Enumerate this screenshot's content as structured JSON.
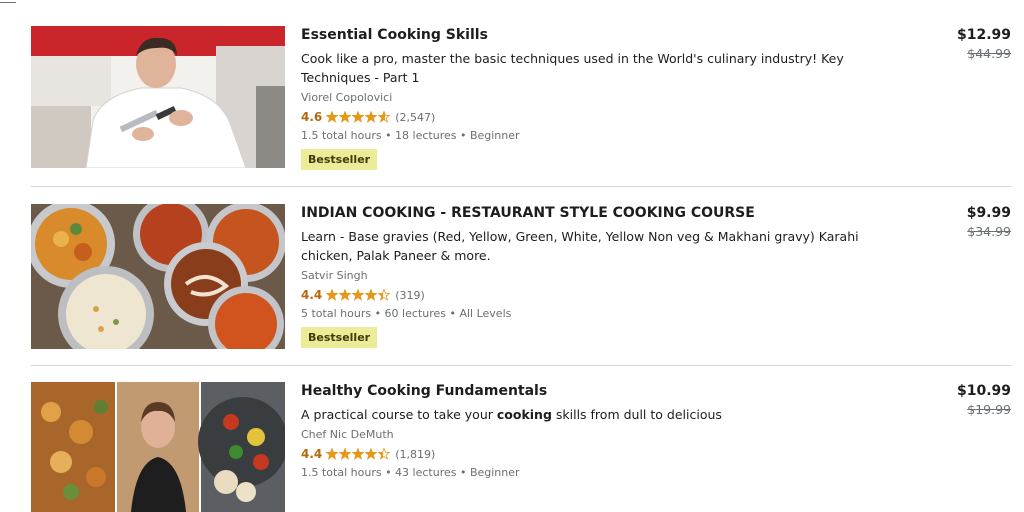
{
  "courses": [
    {
      "title": "Essential Cooking Skills",
      "headline": "Cook like a pro, master the basic techniques used in the World's culinary industry! Key Techniques - Part 1",
      "instructor": "Viorel Copolovici",
      "rating": "4.6",
      "rating_stars": 4.6,
      "rating_count": "(2,547)",
      "meta": "1.5 total hours • 18 lectures • Beginner",
      "badge": "Bestseller",
      "price_current": "$12.99",
      "price_original": "$44.99"
    },
    {
      "title": "INDIAN COOKING - RESTAURANT STYLE COOKING COURSE",
      "headline": "Learn - Base gravies (Red, Yellow, Green, White, Yellow Non veg & Makhani gravy) Karahi chicken, Palak Paneer & more.",
      "instructor": "Satvir Singh",
      "rating": "4.4",
      "rating_stars": 4.4,
      "rating_count": "(319)",
      "meta": "5 total hours • 60 lectures • All Levels",
      "badge": "Bestseller",
      "price_current": "$9.99",
      "price_original": "$34.99"
    },
    {
      "title": "Healthy Cooking Fundamentals",
      "headline_pre": "A practical course to take your ",
      "headline_bold": "cooking",
      "headline_post": " skills from dull to delicious",
      "instructor": "Chef Nic DeMuth",
      "rating": "4.4",
      "rating_stars": 4.4,
      "rating_count": "(1,819)",
      "meta": "1.5 total hours • 43 lectures • Beginner",
      "price_current": "$10.99",
      "price_original": "$19.99"
    }
  ],
  "colors": {
    "rating": "#b4690e",
    "star": "#e59819",
    "badge_bg": "#eceb98",
    "badge_text": "#3d3c0a",
    "divider": "#d1d7dc",
    "muted": "#6a6f73"
  },
  "icons": [
    "star-icon",
    "half-star-icon"
  ]
}
